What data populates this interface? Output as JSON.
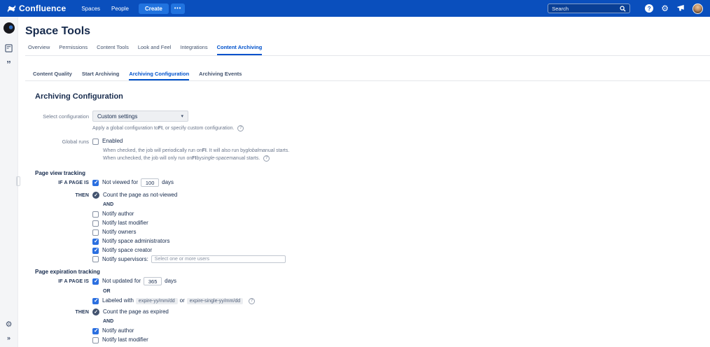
{
  "navbar": {
    "brand": "Confluence",
    "links": [
      {
        "label": "Spaces"
      },
      {
        "label": "People"
      }
    ],
    "create_label": "Create",
    "more_label": "•••",
    "search_placeholder": "Search"
  },
  "icons": {
    "caret": "▾",
    "gear": "⚙",
    "quote": "”",
    "expand": "»"
  },
  "page": {
    "title": "Space Tools",
    "tabs": [
      {
        "label": "Overview",
        "active": false
      },
      {
        "label": "Permissions",
        "active": false
      },
      {
        "label": "Content Tools",
        "active": false
      },
      {
        "label": "Look and Feel",
        "active": false
      },
      {
        "label": "Integrations",
        "active": false
      },
      {
        "label": "Content Archiving",
        "active": true
      }
    ],
    "subtabs": [
      {
        "label": "Content Quality",
        "active": false
      },
      {
        "label": "Start Archiving",
        "active": false
      },
      {
        "label": "Archiving Configuration",
        "active": true
      },
      {
        "label": "Archiving Events",
        "active": false
      }
    ],
    "heading": "Archiving Configuration"
  },
  "config": {
    "select_label": "Select configuration",
    "select_value": "Custom settings",
    "help_pre": "Apply a global configuration to ",
    "help_key": "FI",
    "help_post": ", or specify custom configuration.",
    "global_runs_label": "Global runs",
    "enabled_label": "Enabled",
    "enabled_checked": false,
    "desc1_pre": "When checked, the job will periodically run on ",
    "desc1_key": "FI",
    "desc1_mid": ". It will also run by ",
    "desc1_em": "global",
    "desc1_post": " manual starts.",
    "desc2_pre": "When unchecked, the job will only run on ",
    "desc2_key": "FI",
    "desc2_mid": " by ",
    "desc2_em": "single-space",
    "desc2_post": " manual starts."
  },
  "page_view": {
    "heading": "Page view tracking",
    "if_label": "IF A PAGE IS",
    "condition_checked": true,
    "condition_pre": "Not viewed for",
    "condition_value": "100",
    "condition_post": "days",
    "then_label": "THEN",
    "then_action": "Count the page as not-viewed",
    "and_label": "AND",
    "notify": [
      {
        "label": "Notify author",
        "checked": false
      },
      {
        "label": "Notify last modifier",
        "checked": false
      },
      {
        "label": "Notify owners",
        "checked": false
      },
      {
        "label": "Notify space administrators",
        "checked": true
      },
      {
        "label": "Notify space creator",
        "checked": true
      }
    ],
    "supervisors_checked": false,
    "supervisors_label": "Notify supervisors:",
    "supervisors_placeholder": "Select one or more users"
  },
  "page_expiration": {
    "heading": "Page expiration tracking",
    "if_label": "IF A PAGE IS",
    "condition1_checked": true,
    "condition1_pre": "Not updated for",
    "condition1_value": "365",
    "condition1_post": "days",
    "or_label": "OR",
    "condition2_checked": true,
    "condition2_pre": "Labeled with",
    "condition2_label1": "expire-yy/mm/dd",
    "condition2_or": "or",
    "condition2_label2": "expire-single-yy/mm/dd",
    "then_label": "THEN",
    "then_action": "Count the page as expired",
    "and_label": "AND",
    "notify": [
      {
        "label": "Notify author",
        "checked": true
      },
      {
        "label": "Notify last modifier",
        "checked": false
      }
    ]
  },
  "colors": {
    "navbar": "#0a4fbd",
    "accent": "#0052cc",
    "checkbox": "#2b6fe0"
  }
}
